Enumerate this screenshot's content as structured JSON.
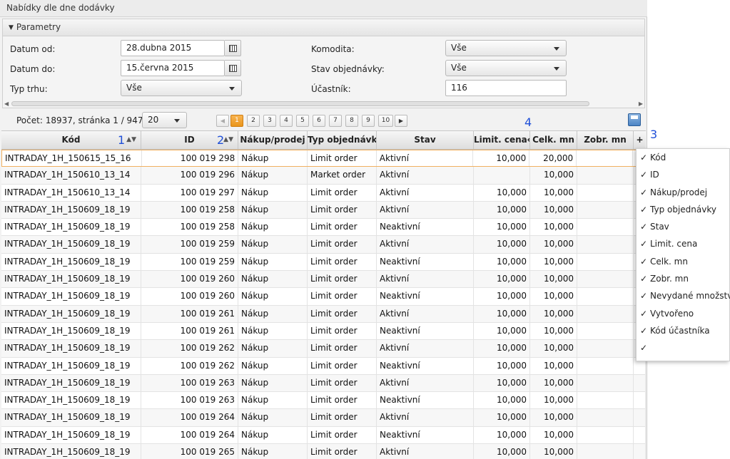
{
  "window": {
    "title": "Nabídky dle dne dodávky"
  },
  "params": {
    "header": "Parametry",
    "date_from_label": "Datum od:",
    "date_from_value": "28.dubna 2015",
    "date_to_label": "Datum do:",
    "date_to_value": "15.června 2015",
    "market_label": "Typ trhu:",
    "market_value": "Vše",
    "commodity_label": "Komodita:",
    "commodity_value": "Vše",
    "order_state_label": "Stav objednávky:",
    "order_state_value": "Vše",
    "participant_label": "Účastník:",
    "participant_value": "116"
  },
  "pager": {
    "count_text": "Počet: 18937, stránka 1 / 947.",
    "page_size": "20",
    "prev": "◀",
    "next": "▶",
    "pages": [
      "1",
      "2",
      "3",
      "4",
      "5",
      "6",
      "7",
      "8",
      "9",
      "10"
    ],
    "active_page": "1"
  },
  "annotations": {
    "a1": "1",
    "a2": "2",
    "a3": "3",
    "a4": "4"
  },
  "table": {
    "headers": [
      "Kód",
      "ID",
      "Nákup/prodej",
      "Typ objednávky",
      "Stav",
      "Limit. cena",
      "Celk. mn",
      "Zobr. mn",
      "+"
    ],
    "resize_glyph": "⟺",
    "sort_kod": "▲▼",
    "sort_id": "▲▼",
    "rows": [
      [
        "INTRADAY_1H_150615_15_16",
        "100 019 298",
        "Nákup",
        "Limit order",
        "Aktivní",
        "10,000",
        "20,000",
        ""
      ],
      [
        "INTRADAY_1H_150610_13_14",
        "100 019 296",
        "Nákup",
        "Market order",
        "Aktivní",
        "",
        "10,000",
        ""
      ],
      [
        "INTRADAY_1H_150610_13_14",
        "100 019 297",
        "Nákup",
        "Limit order",
        "Aktivní",
        "10,000",
        "10,000",
        ""
      ],
      [
        "INTRADAY_1H_150609_18_19",
        "100 019 258",
        "Nákup",
        "Limit order",
        "Aktivní",
        "10,000",
        "10,000",
        ""
      ],
      [
        "INTRADAY_1H_150609_18_19",
        "100 019 258",
        "Nákup",
        "Limit order",
        "Neaktivní",
        "10,000",
        "10,000",
        ""
      ],
      [
        "INTRADAY_1H_150609_18_19",
        "100 019 259",
        "Nákup",
        "Limit order",
        "Aktivní",
        "10,000",
        "10,000",
        ""
      ],
      [
        "INTRADAY_1H_150609_18_19",
        "100 019 259",
        "Nákup",
        "Limit order",
        "Neaktivní",
        "10,000",
        "10,000",
        ""
      ],
      [
        "INTRADAY_1H_150609_18_19",
        "100 019 260",
        "Nákup",
        "Limit order",
        "Aktivní",
        "10,000",
        "10,000",
        ""
      ],
      [
        "INTRADAY_1H_150609_18_19",
        "100 019 260",
        "Nákup",
        "Limit order",
        "Neaktivní",
        "10,000",
        "10,000",
        ""
      ],
      [
        "INTRADAY_1H_150609_18_19",
        "100 019 261",
        "Nákup",
        "Limit order",
        "Aktivní",
        "10,000",
        "10,000",
        ""
      ],
      [
        "INTRADAY_1H_150609_18_19",
        "100 019 261",
        "Nákup",
        "Limit order",
        "Neaktivní",
        "10,000",
        "10,000",
        ""
      ],
      [
        "INTRADAY_1H_150609_18_19",
        "100 019 262",
        "Nákup",
        "Limit order",
        "Aktivní",
        "10,000",
        "10,000",
        ""
      ],
      [
        "INTRADAY_1H_150609_18_19",
        "100 019 262",
        "Nákup",
        "Limit order",
        "Neaktivní",
        "10,000",
        "10,000",
        ""
      ],
      [
        "INTRADAY_1H_150609_18_19",
        "100 019 263",
        "Nákup",
        "Limit order",
        "Aktivní",
        "10,000",
        "10,000",
        ""
      ],
      [
        "INTRADAY_1H_150609_18_19",
        "100 019 263",
        "Nákup",
        "Limit order",
        "Neaktivní",
        "10,000",
        "10,000",
        ""
      ],
      [
        "INTRADAY_1H_150609_18_19",
        "100 019 264",
        "Nákup",
        "Limit order",
        "Aktivní",
        "10,000",
        "10,000",
        ""
      ],
      [
        "INTRADAY_1H_150609_18_19",
        "100 019 264",
        "Nákup",
        "Limit order",
        "Neaktivní",
        "10,000",
        "10,000",
        ""
      ],
      [
        "INTRADAY_1H_150609_18_19",
        "100 019 265",
        "Nákup",
        "Limit order",
        "Aktivní",
        "10,000",
        "10,000",
        ""
      ]
    ]
  },
  "column_menu": {
    "check": "✓",
    "items": [
      "Kód",
      "ID",
      "Nákup/prodej",
      "Typ objednávky",
      "Stav",
      "Limit. cena",
      "Celk. mn",
      "Zobr. mn",
      "Nevydané množství",
      "Vytvořeno",
      "Kód účastníka",
      ""
    ]
  },
  "colors": {
    "accent": "#ea951b",
    "annotation": "#1f4fd8",
    "selection": "#f0b060"
  }
}
